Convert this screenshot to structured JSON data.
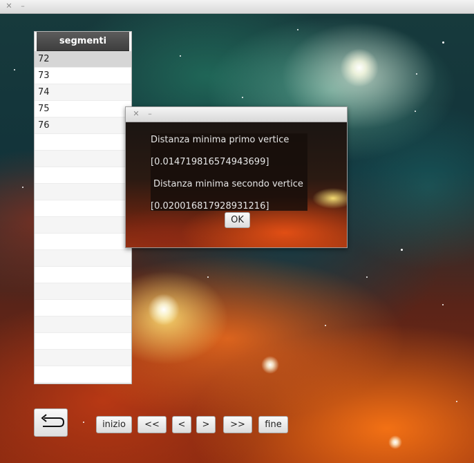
{
  "window": {
    "close_glyph": "✕",
    "minimize_glyph": "–"
  },
  "table": {
    "header": "segmenti",
    "rows": [
      "72",
      "73",
      "74",
      "75",
      "76",
      "",
      "",
      "",
      "",
      "",
      "",
      "",
      "",
      "",
      "",
      "",
      "",
      "",
      "",
      ""
    ],
    "selected_row": "72"
  },
  "dialog": {
    "close_glyph": "✕",
    "minimize_glyph": "–",
    "line1": "Distanza minima primo vertice",
    "line2": "[0.014719816574943699]",
    "line3": "Distanza minima secondo vertice",
    "line4": "[0.020016817928931216]",
    "ok_label": "OK"
  },
  "nav": {
    "first_label": "inizio",
    "prev_many_label": "<<",
    "prev_label": "<",
    "next_label": ">",
    "next_many_label": ">>",
    "last_label": "fine",
    "back_icon": "return-arrow-icon"
  },
  "colors": {
    "table_header_bg": "#4a4a4a",
    "selected_row_bg": "#d6d6d6",
    "button_bg": "#e8e8e8"
  }
}
